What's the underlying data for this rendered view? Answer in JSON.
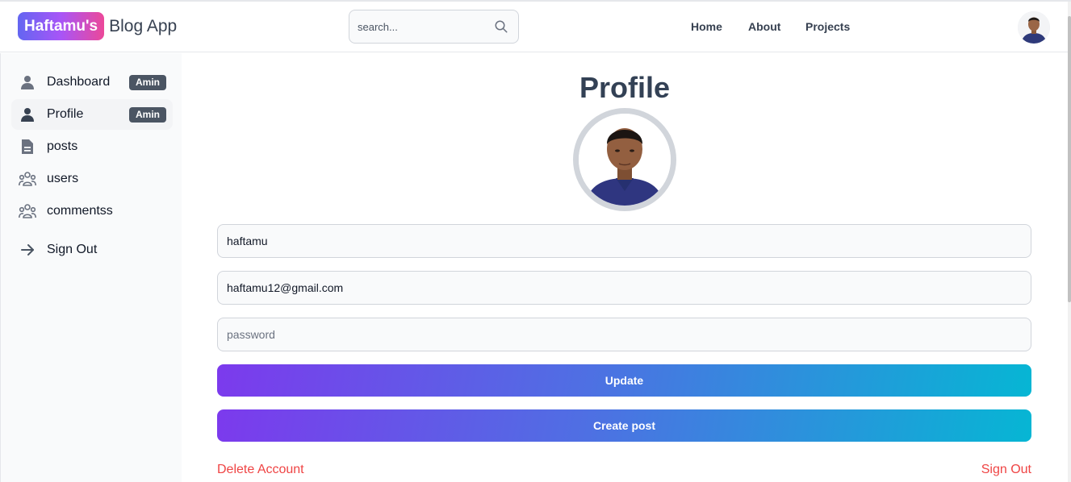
{
  "header": {
    "brand_badge": "Haftamu's",
    "brand_text": "Blog App",
    "search_placeholder": "search...",
    "nav": [
      "Home",
      "About",
      "Projects"
    ]
  },
  "sidebar": {
    "items": [
      {
        "label": "Dashboard",
        "tag": "Amin",
        "icon": "user-icon"
      },
      {
        "label": "Profile",
        "tag": "Amin",
        "icon": "user-icon"
      },
      {
        "label": "posts",
        "icon": "document-icon"
      },
      {
        "label": "users",
        "icon": "users-group-icon"
      },
      {
        "label": "commentss",
        "icon": "users-group-icon"
      },
      {
        "label": "Sign Out",
        "icon": "arrow-right-icon"
      }
    ]
  },
  "main": {
    "title": "Profile",
    "username_value": "haftamu",
    "email_value": "haftamu12@gmail.com",
    "password_placeholder": "password",
    "update_label": "Update",
    "create_post_label": "Create post",
    "delete_account_label": "Delete Account",
    "sign_out_label": "Sign Out"
  },
  "colors": {
    "accent_gradient_start": "#7c3aed",
    "accent_gradient_end": "#06b6d4",
    "danger": "#ef4444",
    "badge_bg": "#4b5563"
  }
}
